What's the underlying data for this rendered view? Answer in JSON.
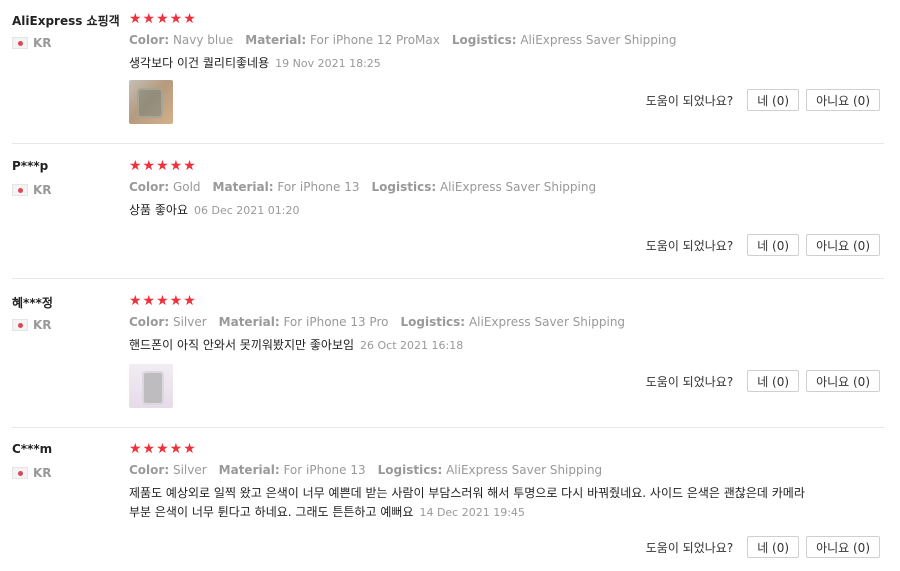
{
  "reviews": [
    {
      "user": "AliExpress 쇼핑객",
      "country": "KR",
      "stars": "★★★★★",
      "color_label": "Color:",
      "color": "Navy blue",
      "material_label": "Material:",
      "material": "For iPhone 12 ProMax",
      "logistics_label": "Logistics:",
      "logistics": "AliExpress Saver Shipping",
      "text": "생각보다 이건 퀄리티좋네용",
      "date": "19 Nov 2021 18:25",
      "helpful_q": "도움이 되었나요?",
      "yes": "네 (0)",
      "no": "아니요 (0)"
    },
    {
      "user": "P***p",
      "country": "KR",
      "stars": "★★★★★",
      "color_label": "Color:",
      "color": "Gold",
      "material_label": "Material:",
      "material": "For iPhone 13",
      "logistics_label": "Logistics:",
      "logistics": "AliExpress Saver Shipping",
      "text": "상품 좋아요",
      "date": "06 Dec 2021 01:20",
      "helpful_q": "도움이 되었나요?",
      "yes": "네 (0)",
      "no": "아니요 (0)"
    },
    {
      "user": "혜***정",
      "country": "KR",
      "stars": "★★★★★",
      "color_label": "Color:",
      "color": "Silver",
      "material_label": "Material:",
      "material": "For iPhone 13 Pro",
      "logistics_label": "Logistics:",
      "logistics": "AliExpress Saver Shipping",
      "text": "핸드폰이 아직 안와서 못끼워봤지만 좋아보임",
      "date": "26 Oct 2021 16:18",
      "helpful_q": "도움이 되었나요?",
      "yes": "네 (0)",
      "no": "아니요 (0)"
    },
    {
      "user": "C***m",
      "country": "KR",
      "stars": "★★★★★",
      "color_label": "Color:",
      "color": "Silver",
      "material_label": "Material:",
      "material": "For iPhone 13",
      "logistics_label": "Logistics:",
      "logistics": "AliExpress Saver Shipping",
      "text": "제품도 예상외로 일찍 왔고 은색이 너무 예쁜데 받는 사람이 부담스러워 해서 투명으로 다시 바꿔줬네요. 사이드 은색은 괜찮은데 카메라부분 은색이 너무 튄다고 하네요. 그래도 튼튼하고 예뻐요",
      "date": "14 Dec 2021 19:45",
      "helpful_q": "도움이 되었나요?",
      "yes": "네 (0)",
      "no": "아니요 (0)"
    }
  ]
}
